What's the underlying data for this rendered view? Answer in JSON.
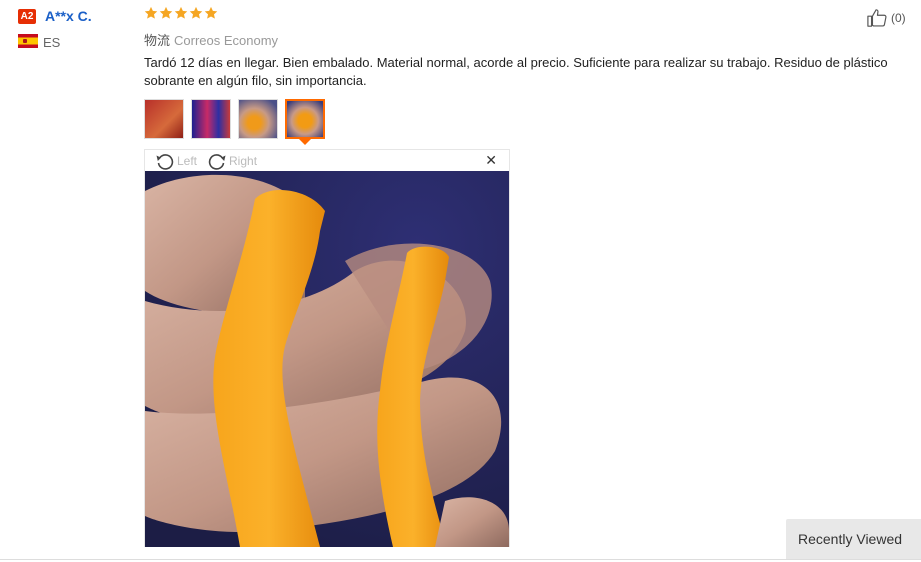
{
  "reviewer": {
    "badge": "A2",
    "name": "A**x C.",
    "country": "ES",
    "flag_colors": [
      "#c60b1e",
      "#ffc400"
    ]
  },
  "rating": {
    "stars": 5,
    "max": 5,
    "star_color": "#f5a623"
  },
  "shipping": {
    "label": "物流",
    "method": "Correos Economy"
  },
  "review": {
    "text": "Tardó 12 días en llegar. Bien embalado. Material normal, acorde al precio. Suficiente para realizar su trabajo. Residuo de plástico sobrante en algún filo, sin importancia."
  },
  "helpful": {
    "count_text": "(0)",
    "icon": "thumbs-up-icon"
  },
  "thumbnails": [
    {
      "name": "review-photo-thumb-1",
      "active": false
    },
    {
      "name": "review-photo-thumb-2",
      "active": false
    },
    {
      "name": "review-photo-thumb-3",
      "active": false
    },
    {
      "name": "review-photo-thumb-4",
      "active": true
    }
  ],
  "viewer": {
    "rotate_left_label": "Left",
    "rotate_right_label": "Right",
    "close_symbol": "✕"
  },
  "recently_viewed": {
    "label": "Recently Viewed"
  },
  "colors": {
    "accent": "#ff6a00",
    "link": "#1a5fc7",
    "badge": "#e62e04"
  }
}
